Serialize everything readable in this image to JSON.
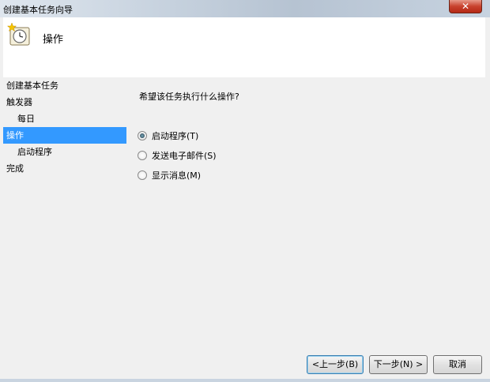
{
  "window": {
    "title": "创建基本任务向导",
    "close_label": "✕"
  },
  "header": {
    "title": "操作",
    "icon": "task-scheduler-clock-icon"
  },
  "nav": {
    "items": [
      {
        "label": "创建基本任务"
      },
      {
        "label": "触发器"
      },
      {
        "label": "每日"
      },
      {
        "label": "操作"
      },
      {
        "label": "启动程序"
      },
      {
        "label": "完成"
      }
    ]
  },
  "content": {
    "question": "希望该任务执行什么操作?",
    "options": [
      {
        "label": "启动程序(T)",
        "selected": true
      },
      {
        "label": "发送电子邮件(S)",
        "selected": false
      },
      {
        "label": "显示消息(M)",
        "selected": false
      }
    ]
  },
  "buttons": {
    "back": "<上一步(B)",
    "next": "下一步(N) >",
    "cancel": "取消"
  }
}
